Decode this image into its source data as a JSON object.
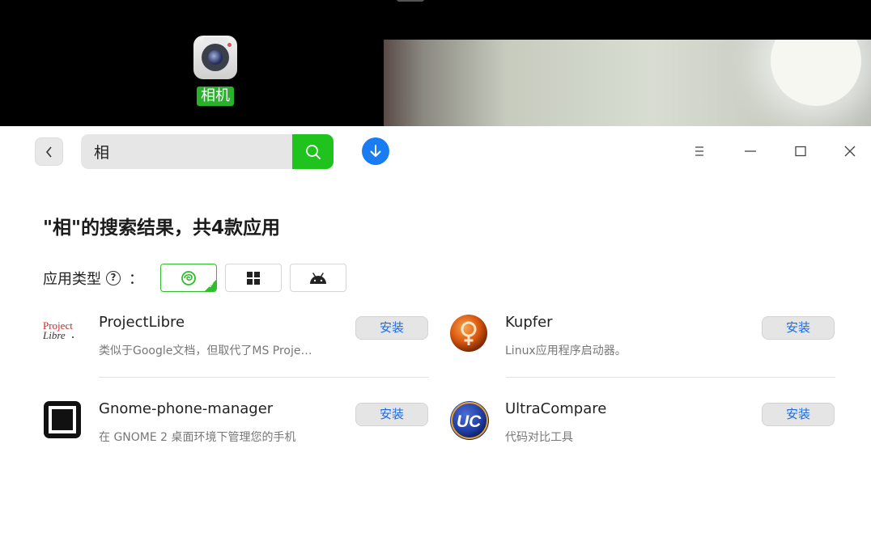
{
  "desktop": {
    "camera_app_label": "相机"
  },
  "window": {
    "search": {
      "value": "相"
    },
    "result_title": "\"相\"的搜索结果，共4款应用",
    "filter": {
      "label": "应用类型",
      "help_icon": "?",
      "colon": "：",
      "options": [
        "deepin",
        "windows",
        "android"
      ],
      "selected": "deepin"
    },
    "colors": {
      "accent_green": "#20c31d",
      "download_blue": "#1a7cf2",
      "install_text": "#1a6ce6"
    },
    "apps": [
      {
        "name": "ProjectLibre",
        "desc": "类似于Google文档，但取代了MS Proje…",
        "install": "安装",
        "icon": "projectlibre-logo",
        "logo_text_1": "Project",
        "logo_text_2": "Libre"
      },
      {
        "name": "Kupfer",
        "desc": "Linux应用程序启动器。",
        "install": "安装",
        "icon": "kupfer-logo"
      },
      {
        "name": "Gnome-phone-manager",
        "desc": "在 GNOME 2 桌面环境下管理您的手机",
        "install": "安装",
        "icon": "gnome-phone-manager-logo"
      },
      {
        "name": "UltraCompare",
        "desc": "代码对比工具",
        "install": "安装",
        "icon": "ultracompare-logo",
        "logo_text": "UC"
      }
    ]
  }
}
